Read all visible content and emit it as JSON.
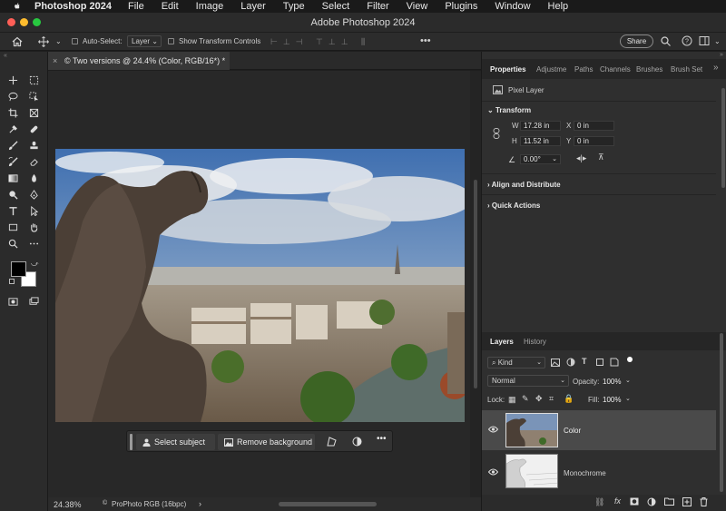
{
  "menubar": {
    "app_name": "Photoshop 2024",
    "items": [
      "File",
      "Edit",
      "Image",
      "Layer",
      "Type",
      "Select",
      "Filter",
      "View",
      "Plugins",
      "Window",
      "Help"
    ]
  },
  "window": {
    "title": "Adobe Photoshop 2024"
  },
  "options_bar": {
    "auto_select_label": "Auto-Select:",
    "auto_select_value": "Layer",
    "show_transform_label": "Show Transform Controls",
    "share_label": "Share"
  },
  "document": {
    "tab_title": "© Two versions @ 24.4% (Color, RGB/16*) *",
    "zoom": "24.38%",
    "color_profile": "ProPhoto RGB (16bpc)"
  },
  "contextual_bar": {
    "select_subject": "Select subject",
    "remove_background": "Remove background"
  },
  "properties_panel": {
    "tabs": [
      "Properties",
      "Adjustme",
      "Paths",
      "Channels",
      "Brushes",
      "Brush Set"
    ],
    "layer_type": "Pixel Layer",
    "transform_title": "Transform",
    "w_label": "W",
    "w_value": "17.28 in",
    "h_label": "H",
    "h_value": "11.52 in",
    "x_label": "X",
    "x_value": "0 in",
    "y_label": "Y",
    "y_value": "0 in",
    "angle_value": "0.00°",
    "align_title": "Align and Distribute",
    "quick_actions_title": "Quick Actions"
  },
  "layers_panel": {
    "tabs": [
      "Layers",
      "History"
    ],
    "filter_kind": "Kind",
    "blend_mode": "Normal",
    "opacity_label": "Opacity:",
    "opacity_value": "100%",
    "lock_label": "Lock:",
    "fill_label": "Fill:",
    "fill_value": "100%",
    "layers": [
      {
        "name": "Color",
        "selected": true
      },
      {
        "name": "Monochrome",
        "selected": false
      }
    ]
  },
  "colors": {
    "close": "#ff5f57",
    "minimize": "#febc2e",
    "zoom": "#28c840",
    "selected_layer": "#4a4a4a"
  }
}
